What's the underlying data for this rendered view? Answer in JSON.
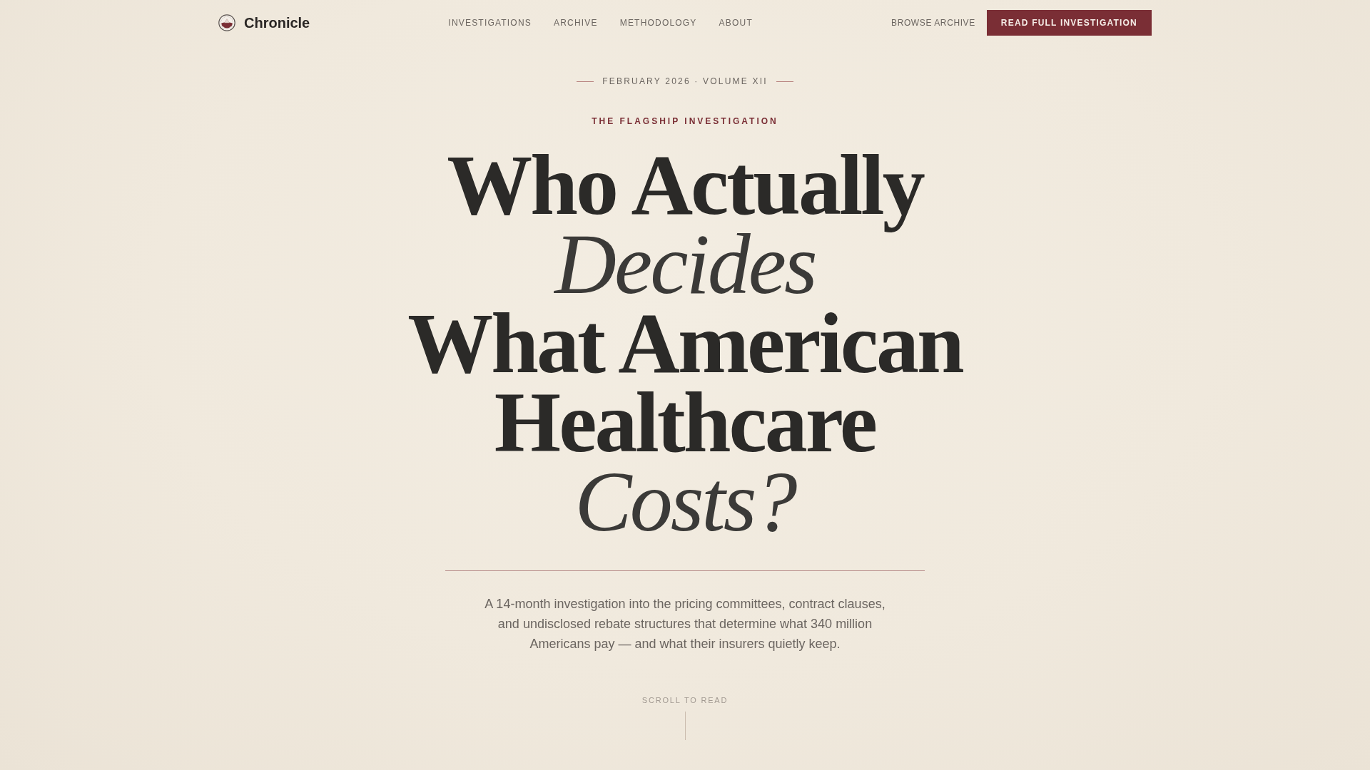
{
  "brand": {
    "name": "Chronicle"
  },
  "nav": [
    "INVESTIGATIONS",
    "ARCHIVE",
    "METHODOLOGY",
    "ABOUT"
  ],
  "actions": {
    "link": "BROWSE ARCHIVE",
    "button": "READ FULL INVESTIGATION"
  },
  "hero": {
    "dateline": "FEBRUARY 2026 · VOLUME XII",
    "kicker": "THE FLAGSHIP INVESTIGATION",
    "headline": "Who Actually *Decides* What American Healthcare *Costs?*",
    "dek": "A 14-month investigation into the pricing committees, contract clauses, and undisclosed rebate structures that determine what 340 million Americans pay — and what their insurers quietly keep.",
    "scroll_cue": "SCROLL TO READ"
  }
}
